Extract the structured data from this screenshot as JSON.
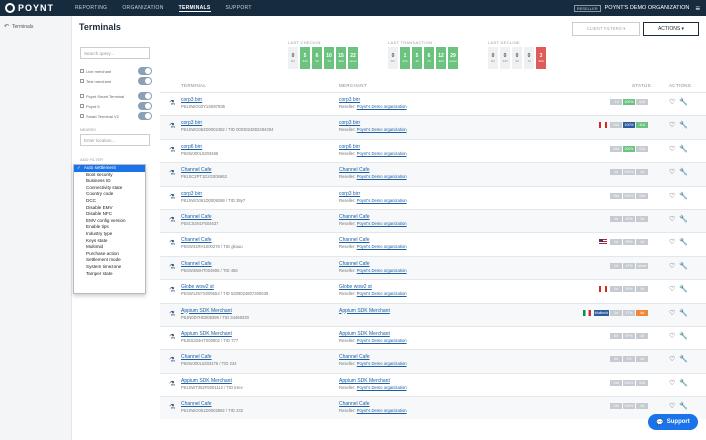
{
  "header": {
    "logo": "POYNT",
    "nav": [
      "REPORTING",
      "ORGANIZATION",
      "TERMINALS",
      "SUPPORT"
    ],
    "badge": "RESELLER",
    "org": "POYNT'S DEMO ORGANIZATION",
    "menu_icon": "hamburger-icon"
  },
  "sidebar": {
    "back_icon": "back-arrow-icon",
    "item": "Terminals"
  },
  "page": {
    "title": "Terminals"
  },
  "filters": {
    "search_placeholder": "Search query...",
    "toggles": [
      "Live merchant",
      "Test merchant",
      "Poynt Smart Terminal",
      "Poynt 5",
      "Smart Terminal V2"
    ],
    "nearby_label": "NEARBY",
    "location_placeholder": "Enter location...",
    "add_filter_label": "ADD FILTER",
    "options": [
      "Auto settlement",
      "Boot security",
      "Business ID",
      "Connectivity state",
      "Country code",
      "DCC",
      "Disable EMV",
      "Disable NFC",
      "EMV config version",
      "Enable tips",
      "Industry type",
      "Keys state",
      "Multimid",
      "Purchase action",
      "Settlement mode",
      "System timezone",
      "Tamper state"
    ]
  },
  "metrics": [
    {
      "title": "LAST CHECKIN",
      "cells": [
        {
          "n": "0",
          "u": "1hr",
          "c": ""
        },
        {
          "n": "5",
          "u": "24h",
          "c": "green"
        },
        {
          "n": "6",
          "u": "3d",
          "c": "green"
        },
        {
          "n": "10",
          "u": "7d",
          "c": "green"
        },
        {
          "n": "15",
          "u": "30d",
          "c": "green"
        },
        {
          "n": "22",
          "u": "never",
          "c": "green"
        }
      ]
    },
    {
      "title": "LAST TRANSACTION",
      "cells": [
        {
          "n": "0",
          "u": "1hr",
          "c": ""
        },
        {
          "n": "1",
          "u": "24h",
          "c": "green"
        },
        {
          "n": "5",
          "u": "3d",
          "c": "green"
        },
        {
          "n": "6",
          "u": "7d",
          "c": "green"
        },
        {
          "n": "12",
          "u": "30d",
          "c": "green"
        },
        {
          "n": "29",
          "u": "never",
          "c": "green"
        }
      ]
    },
    {
      "title": "LAST DECLINE",
      "cells": [
        {
          "n": "0",
          "u": "1hr",
          "c": ""
        },
        {
          "n": "0",
          "u": "24h",
          "c": ""
        },
        {
          "n": "0",
          "u": "3d",
          "c": ""
        },
        {
          "n": "0",
          "u": "7d",
          "c": ""
        },
        {
          "n": "3",
          "u": "30d",
          "c": "red"
        }
      ]
    }
  ],
  "buttons": {
    "client_filters": "CLIENT FILTERS ▾",
    "actions": "ACTIONS ▾"
  },
  "table": {
    "headers": {
      "terminal": "TERMINAL",
      "merchant": "MERCHANT",
      "status": "STATUS",
      "actions": "ACTIONS"
    },
    "rows": [
      {
        "t1": "corp3 birr",
        "t2": "P61SWG03Y1S597936",
        "m1": "corp3 birr",
        "reseller": "Poynt's Demo organization",
        "flag": "",
        "st": [
          {
            "t": "-1d",
            "c": ""
          },
          {
            "t": "100%",
            "c": "green"
          },
          {
            "t": "12d",
            "c": ""
          }
        ]
      },
      {
        "t1": "corp3 birr",
        "t2": "P61SWG062D0002482 / TID 0003024802284304",
        "m1": "corp3 birr",
        "reseller": "Poynt's Demo organization",
        "flag": "ca",
        "st": [
          {
            "t": "10d",
            "c": ""
          },
          {
            "t": "100%",
            "c": "blue"
          },
          {
            "t": "11d",
            "c": "green"
          }
        ]
      },
      {
        "t1": "corp6 birr",
        "t2": "P6SWJ00L5303465",
        "m1": "corp6 birr",
        "reseller": "Poynt's Demo organization",
        "flag": "",
        "st": [
          {
            "t": "10d",
            "c": ""
          },
          {
            "t": "100%",
            "c": "green"
          },
          {
            "t": "12d",
            "c": ""
          }
        ]
      },
      {
        "t1": "Channel Cafe",
        "t2": "P61SC2PT1D2G005963",
        "m1": "Channel Cafe",
        "reseller": "Poynt's Demo organization",
        "flag": "",
        "st": [
          {
            "t": "1d",
            "c": ""
          },
          {
            "t": "100%",
            "c": ""
          },
          {
            "t": "1d",
            "c": ""
          }
        ]
      },
      {
        "t1": "corp3 birr",
        "t2": "P61SWG061D0009288 / TID 39y7",
        "m1": "corp3 birr",
        "reseller": "Poynt's Demo organization",
        "flag": "",
        "st": [
          {
            "t": "15d",
            "c": ""
          },
          {
            "t": "100%",
            "c": ""
          },
          {
            "t": "15d",
            "c": ""
          }
        ]
      },
      {
        "t1": "Channel Cafe",
        "t2": "P5SC53N1F504637",
        "m1": "Channel Cafe",
        "reseller": "Poynt's Demo organization",
        "flag": "",
        "st": [
          {
            "t": "1d",
            "c": ""
          },
          {
            "t": "20%",
            "c": ""
          },
          {
            "t": "1d",
            "c": ""
          }
        ]
      },
      {
        "t1": "Channel Cafe",
        "t2": "P5SW31RH1000278 / TID gkouu",
        "m1": "Channel Cafe",
        "reseller": "Poynt's Demo organization",
        "flag": "us",
        "st": [
          {
            "t": "1d",
            "c": ""
          },
          {
            "t": "95%",
            "c": ""
          },
          {
            "t": "1d",
            "c": ""
          }
        ]
      },
      {
        "t1": "Channel Cafe",
        "t2": "P5SW368HT004906 / TID 456",
        "m1": "Channel Cafe",
        "reseller": "Poynt's Demo organization",
        "flag": "",
        "st": [
          {
            "t": "1d",
            "c": ""
          },
          {
            "t": "47%",
            "c": ""
          },
          {
            "t": "never",
            "c": ""
          }
        ]
      },
      {
        "t1": "Globe wow2 st",
        "t2": "P5SW12N7X005553 / TID 5308024807300639",
        "m1": "Globe wow2 st",
        "reseller": "Poynt's Demo organization",
        "flag": "ca",
        "st": [
          {
            "t": "1d",
            "c": ""
          },
          {
            "t": "90%",
            "c": ""
          },
          {
            "t": "1d",
            "c": ""
          }
        ]
      },
      {
        "t1": "Appium SDK Merchant",
        "t2": "P6JN0D7HD008396 / TID 34468330",
        "m1": "Appium SDK Merchant",
        "reseller": "",
        "flag": "it",
        "st": [
          {
            "t": "Multimid",
            "c": "blue"
          },
          {
            "t": "3d",
            "c": ""
          },
          {
            "t": "17%",
            "c": ""
          },
          {
            "t": "4d",
            "c": "orange"
          }
        ]
      },
      {
        "t1": "Appium SDK Merchant",
        "t2": "P5JE5334HT000802 / TID 777",
        "m1": "Appium SDK Merchant",
        "reseller": "Poynt's Demo organization",
        "flag": "",
        "st": [
          {
            "t": "5d",
            "c": ""
          },
          {
            "t": "97%",
            "c": ""
          },
          {
            "t": "1d",
            "c": ""
          }
        ]
      },
      {
        "t1": "Channel Cafe",
        "t2": "P6SWJ00L5303476 / TID 234",
        "m1": "Channel Cafe",
        "reseller": "Poynt's Demo organization",
        "flag": "",
        "st": [
          {
            "t": "4d",
            "c": ""
          },
          {
            "t": "1%",
            "c": ""
          },
          {
            "t": "4d",
            "c": ""
          }
        ]
      },
      {
        "t1": "Appium SDK Merchant",
        "t2": "P61SWT352F5001112 / TID iHev",
        "m1": "Appium SDK Merchant",
        "reseller": "Poynt's Demo organization",
        "flag": "",
        "st": [
          {
            "t": "13d",
            "c": ""
          },
          {
            "t": "100%",
            "c": ""
          },
          {
            "t": "13d",
            "c": ""
          }
        ]
      },
      {
        "t1": "Channel Cafe",
        "t2": "P61SWG061D0002892 / TID 232",
        "m1": "Channel Cafe",
        "reseller": "Poynt's Demo organization",
        "flag": "",
        "st": [
          {
            "t": "13d",
            "c": ""
          },
          {
            "t": "100%",
            "c": ""
          },
          {
            "t": "1d",
            "c": ""
          }
        ]
      }
    ]
  },
  "support": "Support"
}
